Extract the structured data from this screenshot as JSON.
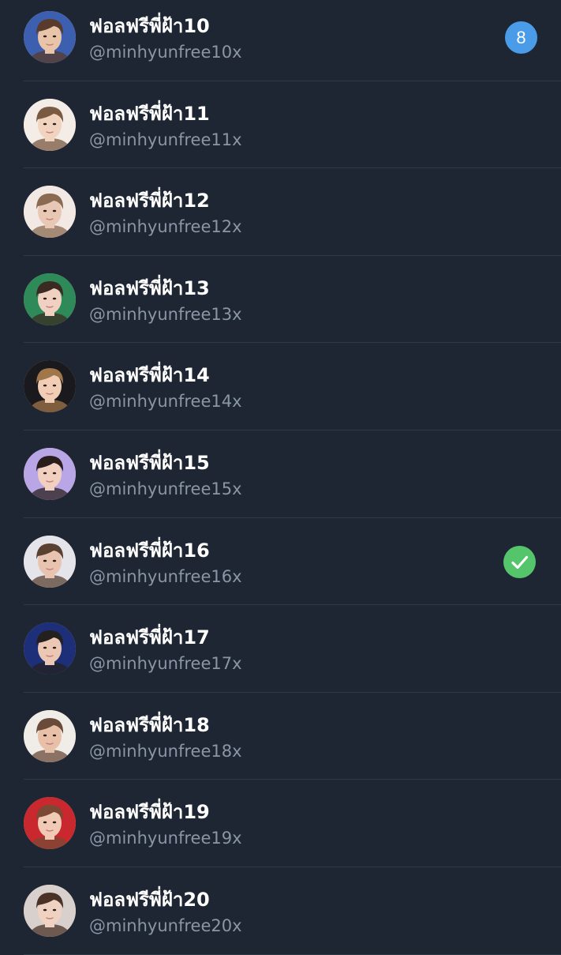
{
  "accounts": [
    {
      "name": "ฟอลฟรีพี่ฝ้า10",
      "handle": "@minhyunfree10x",
      "badge": "8",
      "avatar_bg": "#3d5fb0",
      "skin": "#e8c4a8",
      "hair": "#5a3a2a"
    },
    {
      "name": "ฟอลฟรีพี่ฝ้า11",
      "handle": "@minhyunfree11x",
      "avatar_bg": "#f4ece6",
      "skin": "#f0d4c0",
      "hair": "#7a5a40"
    },
    {
      "name": "ฟอลฟรีพี่ฝ้า12",
      "handle": "@minhyunfree12x",
      "avatar_bg": "#f2e8e4",
      "skin": "#e8c8b4",
      "hair": "#8a6a50"
    },
    {
      "name": "ฟอลฟรีพี่ฝ้า13",
      "handle": "@minhyunfree13x",
      "avatar_bg": "#2f8a5a",
      "skin": "#f0d0c0",
      "hair": "#3a2a22"
    },
    {
      "name": "ฟอลฟรีพี่ฝ้า14",
      "handle": "@minhyunfree14x",
      "avatar_bg": "#1a1a1e",
      "skin": "#f0cdb4",
      "hair": "#a0764a"
    },
    {
      "name": "ฟอลฟรีพี่ฝ้า15",
      "handle": "@minhyunfree15x",
      "avatar_bg": "#b9a6e6",
      "skin": "#f2d0c0",
      "hair": "#2a1e1c"
    },
    {
      "name": "ฟอลฟรีพี่ฝ้า16",
      "handle": "@minhyunfree16x",
      "status": "verified-check",
      "avatar_bg": "#e4e4ea",
      "skin": "#e8c4b0",
      "hair": "#5a4030"
    },
    {
      "name": "ฟอลฟรีพี่ฝ้า17",
      "handle": "@minhyunfree17x",
      "avatar_bg": "#1e2f7a",
      "skin": "#ecc8b4",
      "hair": "#24201e"
    },
    {
      "name": "ฟอลฟรีพี่ฝ้า18",
      "handle": "@minhyunfree18x",
      "avatar_bg": "#f0ece8",
      "skin": "#e8c0a8",
      "hair": "#6a4a38"
    },
    {
      "name": "ฟอลฟรีพี่ฝ้า19",
      "handle": "@minhyunfree19x",
      "avatar_bg": "#c8282e",
      "skin": "#f0cab4",
      "hair": "#7a4a34"
    },
    {
      "name": "ฟอลฟรีพี่ฝ้า20",
      "handle": "@minhyunfree20x",
      "avatar_bg": "#d8d0cc",
      "skin": "#f0d2c2",
      "hair": "#4a3226"
    }
  ],
  "colors": {
    "background": "#1e2633",
    "divider": "#2f3a49",
    "handle_text": "#8a96a6",
    "badge": "#4a9be8",
    "check": "#55c56c"
  }
}
